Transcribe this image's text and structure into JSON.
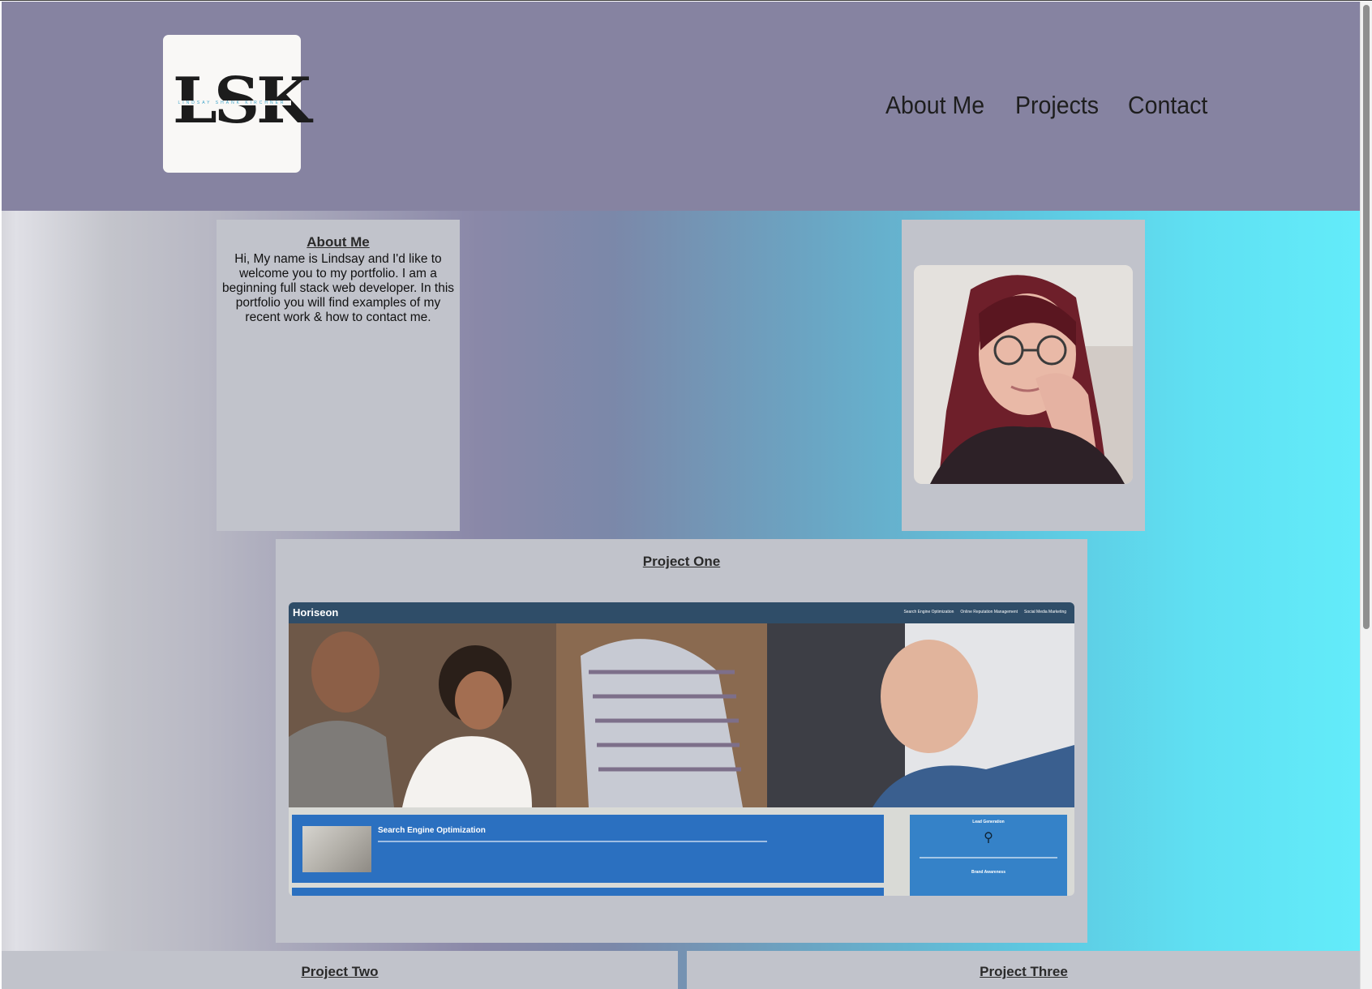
{
  "header": {
    "logo_letters": "LSK",
    "logo_tagline": "LINDSAY SHANK KIRCHNER",
    "nav": [
      {
        "label": "About Me"
      },
      {
        "label": "Projects"
      },
      {
        "label": "Contact"
      }
    ]
  },
  "about": {
    "title": "About Me",
    "text": "Hi, My name is Lindsay and I'd like to welcome you to my portfolio. I am a beginning full stack web developer. In this portfolio you will find examples of my recent work & how to contact me."
  },
  "projects": [
    {
      "title": "Project One",
      "screenshot": {
        "brand": "Horiseon",
        "nav": [
          "Search Engine Optimization",
          "Online Reputation Management",
          "Social Media Marketing"
        ],
        "main_title": "Search Engine Optimization",
        "side_title": "Lead Generation",
        "side_title_2": "Brand Awareness"
      }
    },
    {
      "title": "Project Two"
    },
    {
      "title": "Project Three"
    }
  ],
  "colors": {
    "header_bg": "#8683a1",
    "card_bg": "#c1c3cb",
    "gradient_right": "#63ecfa"
  }
}
